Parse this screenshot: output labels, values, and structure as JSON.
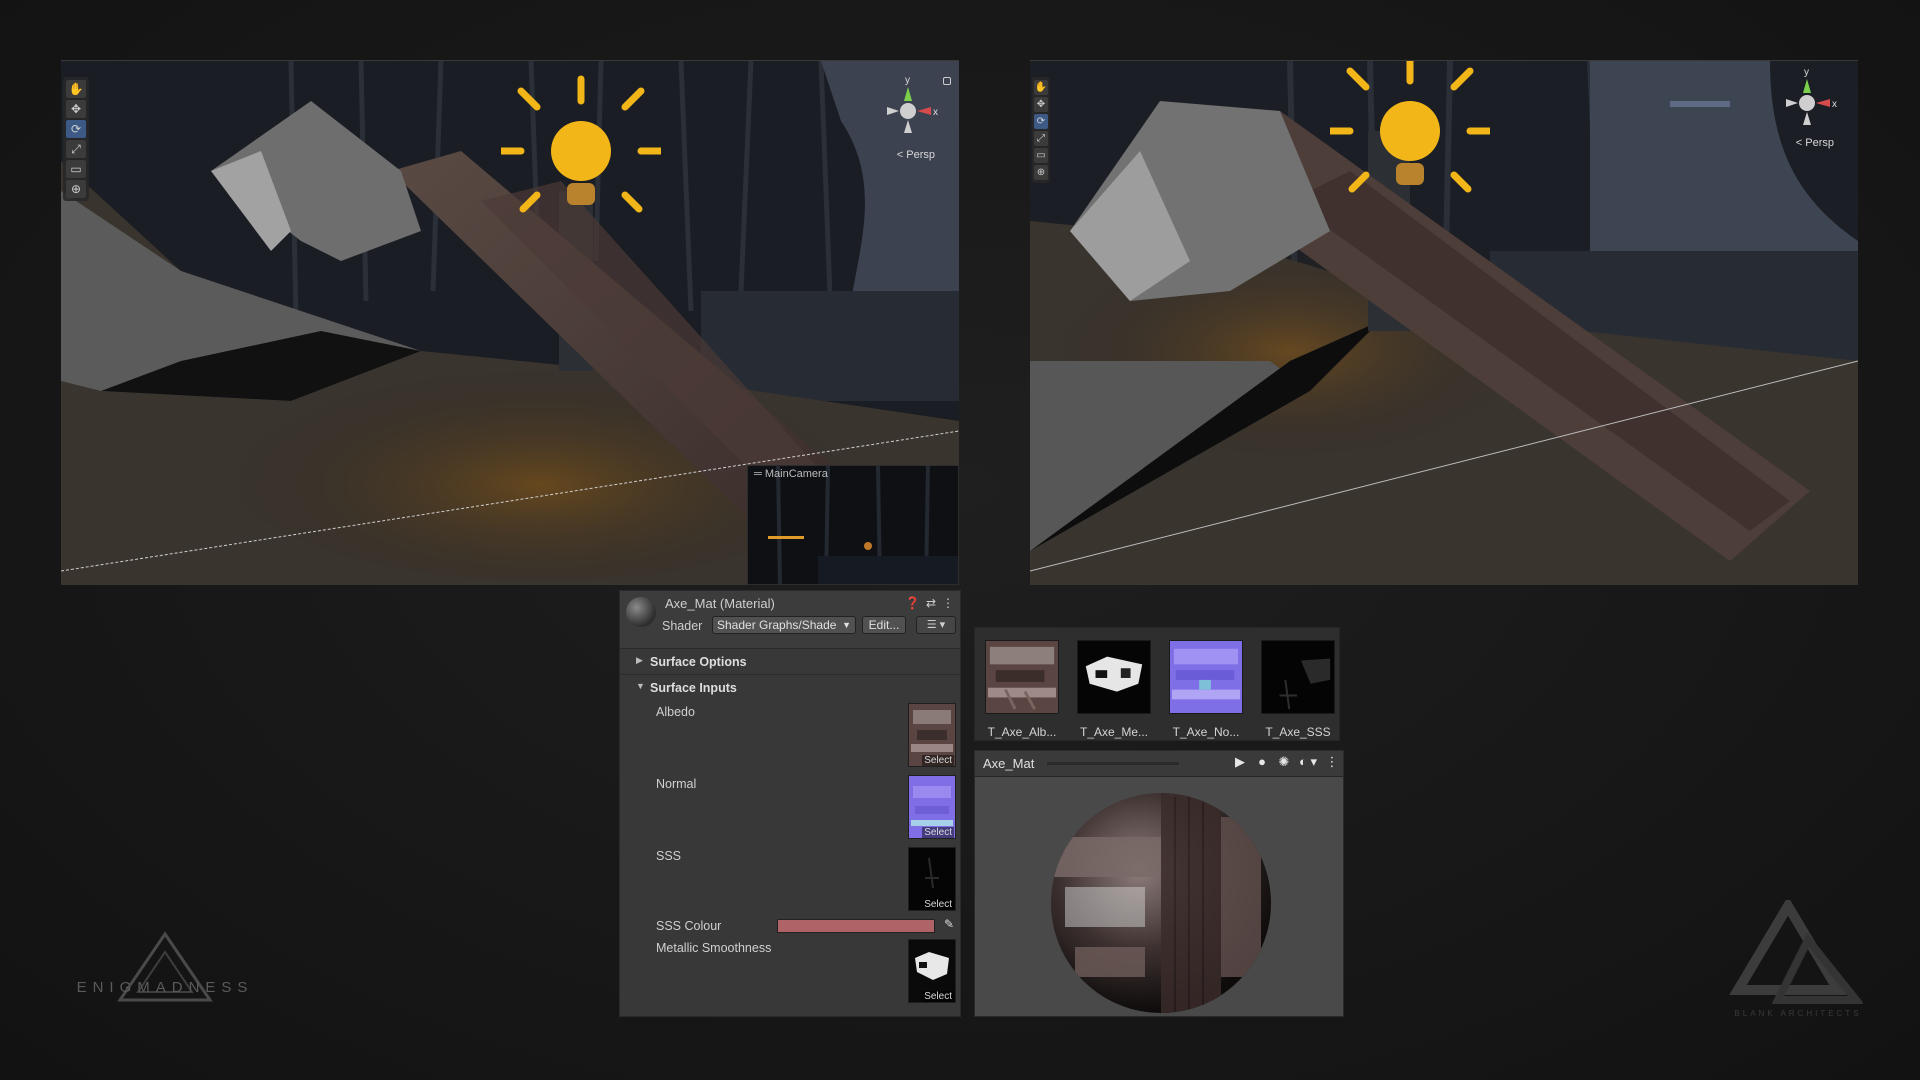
{
  "left_viewport": {
    "tools": [
      "✋",
      "✥",
      "⟳",
      "⤢",
      "▭",
      "⊕"
    ],
    "active_tool": 2,
    "gizmo": {
      "y": "y",
      "x": "x"
    },
    "persp_label": "Persp",
    "camera_preview_label": "MainCamera"
  },
  "right_viewport": {
    "tools": [
      "✋",
      "✥",
      "⟳",
      "⤢",
      "▭",
      "⊕"
    ],
    "active_tool": 2,
    "gizmo": {
      "y": "y",
      "x": "x"
    },
    "persp_label": "Persp"
  },
  "inspector": {
    "title": "Axe_Mat (Material)",
    "header_icons": [
      "❓",
      "⇄",
      "⋮"
    ],
    "shader_label": "Shader",
    "shader_value": "Shader Graphs/Shade",
    "edit_label": "Edit...",
    "list_label": "☰ ▾",
    "sections": {
      "surface_options": "Surface Options",
      "surface_inputs": "Surface Inputs"
    },
    "properties": {
      "albedo": "Albedo",
      "normal": "Normal",
      "sss": "SSS",
      "sss_colour": "SSS Colour",
      "metallic_smoothness": "Metallic Smoothness"
    },
    "select_label": "Select",
    "sss_colour_value": "#b06367"
  },
  "textures": [
    {
      "name": "T_Axe_Alb..."
    },
    {
      "name": "T_Axe_Me..."
    },
    {
      "name": "T_Axe_No..."
    },
    {
      "name": "T_Axe_SSS"
    }
  ],
  "preview": {
    "title": "Axe_Mat",
    "tools": [
      "▶",
      "●",
      "✺",
      "◐ ▾",
      "⋮"
    ]
  },
  "logos": {
    "left_text": "ENIGMADNESS",
    "right_text": "BLANK ARCHITECTS"
  }
}
